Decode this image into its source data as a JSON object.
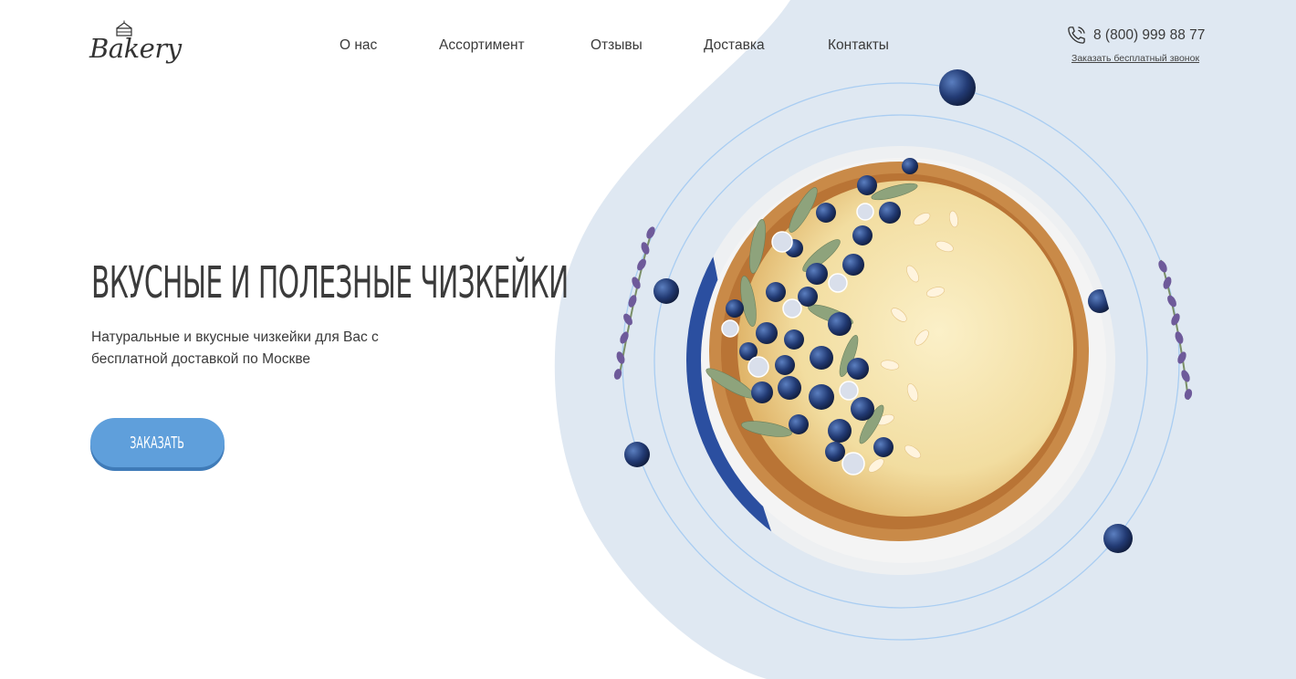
{
  "colors": {
    "accent": "#5f9fdb",
    "accent_shadow": "#3f7bb8",
    "blob": "#dfe8f2",
    "orbit": "#a9cdf2",
    "text": "#3b3b3b"
  },
  "logo": {
    "text": "Bakery",
    "icon": "cake-icon"
  },
  "nav": {
    "items": [
      {
        "label": "О нас"
      },
      {
        "label": "Ассортимент"
      },
      {
        "label": "Отзывы"
      },
      {
        "label": "Доставка"
      },
      {
        "label": "Контакты"
      }
    ]
  },
  "contact": {
    "phone": "8 (800) 999 88 77",
    "phone_icon": "phone-icon",
    "callback_link": "Заказать бесплатный звонок"
  },
  "hero": {
    "title": "Вкусные и полезные чизкейки",
    "subtitle": "Натуральные и вкусные чизкейки для Вас с бесплатной доставкой по Москве",
    "cta_label": "Заказать"
  },
  "illustration": {
    "subject": "cheesecake with blueberries and almond flakes",
    "decorations": [
      "blueberry",
      "lavender-sprig",
      "orbit-ring"
    ]
  }
}
